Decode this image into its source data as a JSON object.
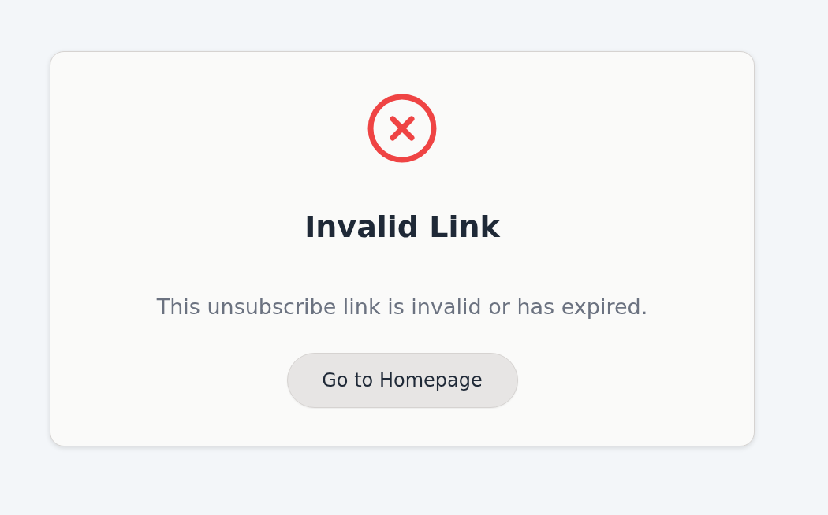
{
  "title": "Invalid Link",
  "message": "This unsubscribe link is invalid or has expired.",
  "button": {
    "label": "Go to Homepage"
  }
}
